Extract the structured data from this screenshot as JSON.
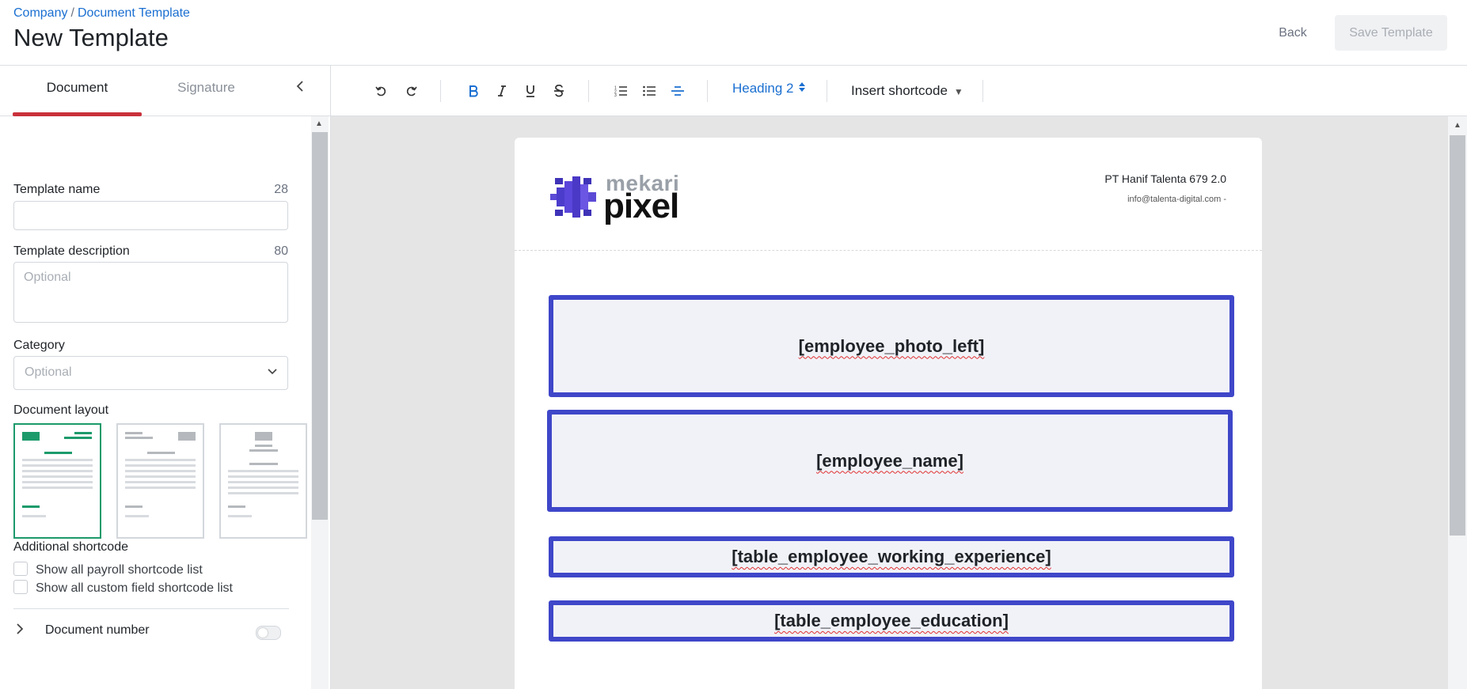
{
  "header": {
    "breadcrumb": [
      "Company",
      "Document Template"
    ],
    "breadcrumb_sep": "/",
    "title": "New Template",
    "back_label": "Back",
    "save_label": "Save Template"
  },
  "sidebar": {
    "tabs": [
      {
        "label": "Document",
        "active": true
      },
      {
        "label": "Signature",
        "active": false
      }
    ],
    "template_name": {
      "label": "Template name",
      "count": "28",
      "value": "",
      "placeholder": ""
    },
    "template_description": {
      "label": "Template description",
      "count": "80",
      "value": "",
      "placeholder": "Optional"
    },
    "category": {
      "label": "Category",
      "placeholder": "Optional"
    },
    "document_layout": {
      "label": "Document layout",
      "selected_index": 0
    },
    "additional_shortcode": {
      "label": "Additional shortcode",
      "options": [
        {
          "label": "Show all payroll shortcode list",
          "checked": false
        },
        {
          "label": "Show all custom field shortcode list",
          "checked": false
        }
      ]
    },
    "document_number": {
      "label": "Document number",
      "enabled": false
    }
  },
  "toolbar": {
    "icons": [
      "undo-icon",
      "redo-icon",
      "bold-icon",
      "italic-icon",
      "underline-icon",
      "strikethrough-icon",
      "ordered-list-icon",
      "bullet-list-icon",
      "align-center-icon"
    ],
    "heading": "Heading 2",
    "insert_shortcode": "Insert shortcode"
  },
  "document": {
    "logo_top": "mekari",
    "logo_bottom": "pixel",
    "company_name": "PT Hanif Talenta 679 2.0",
    "company_email": "info@talenta-digital.com -",
    "shortcodes": [
      "[employee_photo_left]",
      "[employee_name]",
      "[table_employee_working_experience]",
      "[table_employee_education]"
    ]
  },
  "colors": {
    "accent_blue": "#1a6fd1",
    "tab_indicator": "#c9303b",
    "selected_layout": "#1c9a6b",
    "shortcode_border": "#3f47c9"
  }
}
